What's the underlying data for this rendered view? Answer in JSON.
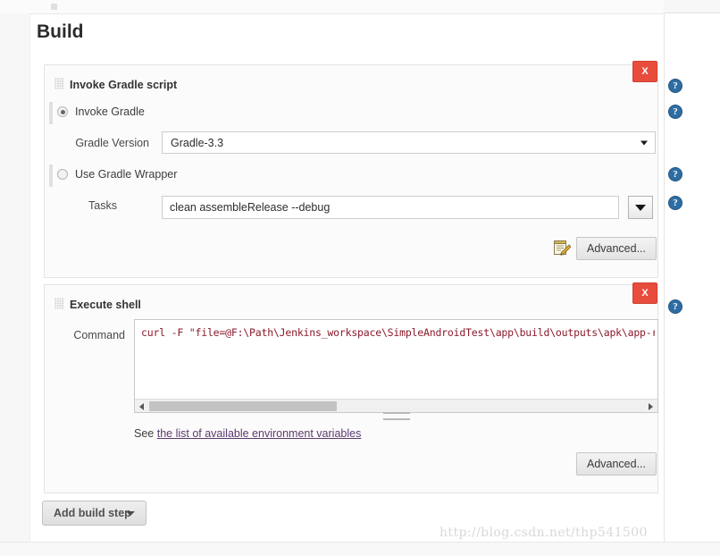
{
  "page": {
    "section_title": "Build",
    "watermark": "http://blog.csdn.net/thp541500"
  },
  "steps": [
    {
      "title": "Invoke Gradle script",
      "remove_label": "X",
      "grip_icon": "drag-grip-icon",
      "options": [
        {
          "label": "Invoke Gradle",
          "selected": true
        },
        {
          "label": "Use Gradle Wrapper",
          "selected": false
        }
      ],
      "fields": {
        "gradle_version_label": "Gradle Version",
        "gradle_version_value": "Gradle-3.3",
        "tasks_label": "Tasks",
        "tasks_value": "clean assembleRelease --debug",
        "tasks_placeholder": ""
      },
      "advanced_label": "Advanced...",
      "notepad_icon": "notepad-pencil-icon"
    },
    {
      "title": "Execute shell",
      "remove_label": "X",
      "grip_icon": "drag-grip-icon",
      "fields": {
        "command_label": "Command",
        "command_value": "curl -F \"file=@F:\\Path\\Jenkins_workspace\\SimpleAndroidTest\\app\\build\\outputs\\apk\\app-rele",
        "command_placeholder": ""
      },
      "help_line_prefix": "See",
      "help_line_link": "the list of available environment variables",
      "advanced_label": "Advanced..."
    }
  ],
  "toolbar": {
    "add_build_step_label": "Add build step",
    "add_build_step_caret": "chevron-down-icon"
  },
  "help_icons": {
    "glyph": "?",
    "name": "help-icon",
    "count": 5
  },
  "colors": {
    "remove_button": "#e74c3c",
    "help_icon": "#2e6da4",
    "command_text": "#8b1a2b",
    "link": "#5c3a6e"
  }
}
